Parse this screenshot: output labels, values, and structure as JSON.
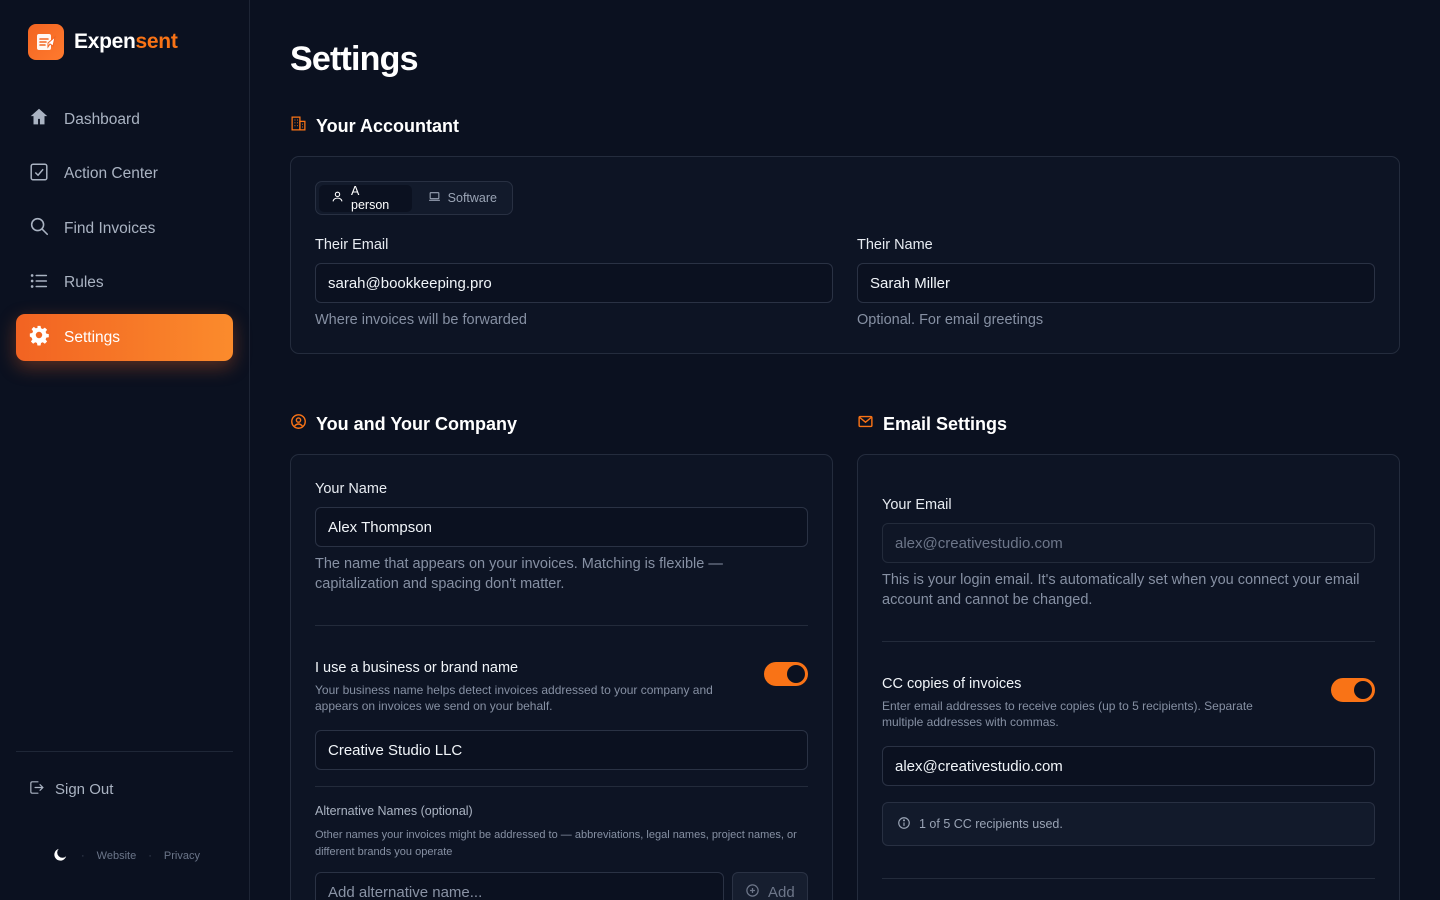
{
  "brand": {
    "name_part1": "Expen",
    "name_part2": "sent"
  },
  "sidebar": {
    "items": [
      {
        "label": "Dashboard",
        "icon": "home-icon"
      },
      {
        "label": "Action Center",
        "icon": "check-square-icon"
      },
      {
        "label": "Find Invoices",
        "icon": "search-icon"
      },
      {
        "label": "Rules",
        "icon": "list-icon"
      },
      {
        "label": "Settings",
        "icon": "gear-icon",
        "active": true
      }
    ],
    "sign_out": "Sign Out",
    "footer": {
      "website": "Website",
      "privacy": "Privacy"
    }
  },
  "page": {
    "title": "Settings"
  },
  "accountant": {
    "heading": "Your Accountant",
    "toggle": {
      "person": "A person",
      "software": "Software",
      "selected": "A person"
    },
    "email_label": "Their Email",
    "email_value": "sarah@bookkeeping.pro",
    "email_hint": "Where invoices will be forwarded",
    "name_label": "Their Name",
    "name_value": "Sarah Miller",
    "name_hint": "Optional. For email greetings"
  },
  "company": {
    "heading": "You and Your Company",
    "your_name_label": "Your Name",
    "your_name_value": "Alex Thompson",
    "your_name_hint": "The name that appears on your invoices. Matching is flexible — capitalization and spacing don't matter.",
    "brand_toggle_title": "I use a business or brand name",
    "brand_toggle_hint": "Your business name helps detect invoices addressed to your company and appears on invoices we send on your behalf.",
    "brand_toggle_on": true,
    "business_name_value": "Creative Studio LLC",
    "alt_names_label": "Alternative Names (optional)",
    "alt_names_hint": "Other names your invoices might be addressed to — abbreviations, legal names, project names, or different brands you operate",
    "alt_names_placeholder": "Add alternative name...",
    "add_button": "Add"
  },
  "email_settings": {
    "heading": "Email Settings",
    "your_email_label": "Your Email",
    "your_email_value": "alex@creativestudio.com",
    "your_email_hint": "This is your login email. It's automatically set when you connect your email account and cannot be changed.",
    "cc_title": "CC copies of invoices",
    "cc_hint": "Enter email addresses to receive copies (up to 5 recipients). Separate multiple addresses with commas.",
    "cc_on": true,
    "cc_value": "alex@creativestudio.com",
    "cc_info": "1 of 5 CC recipients used."
  },
  "colors": {
    "accent": "#f97316",
    "background": "#0b1120",
    "card": "#0d1424"
  }
}
